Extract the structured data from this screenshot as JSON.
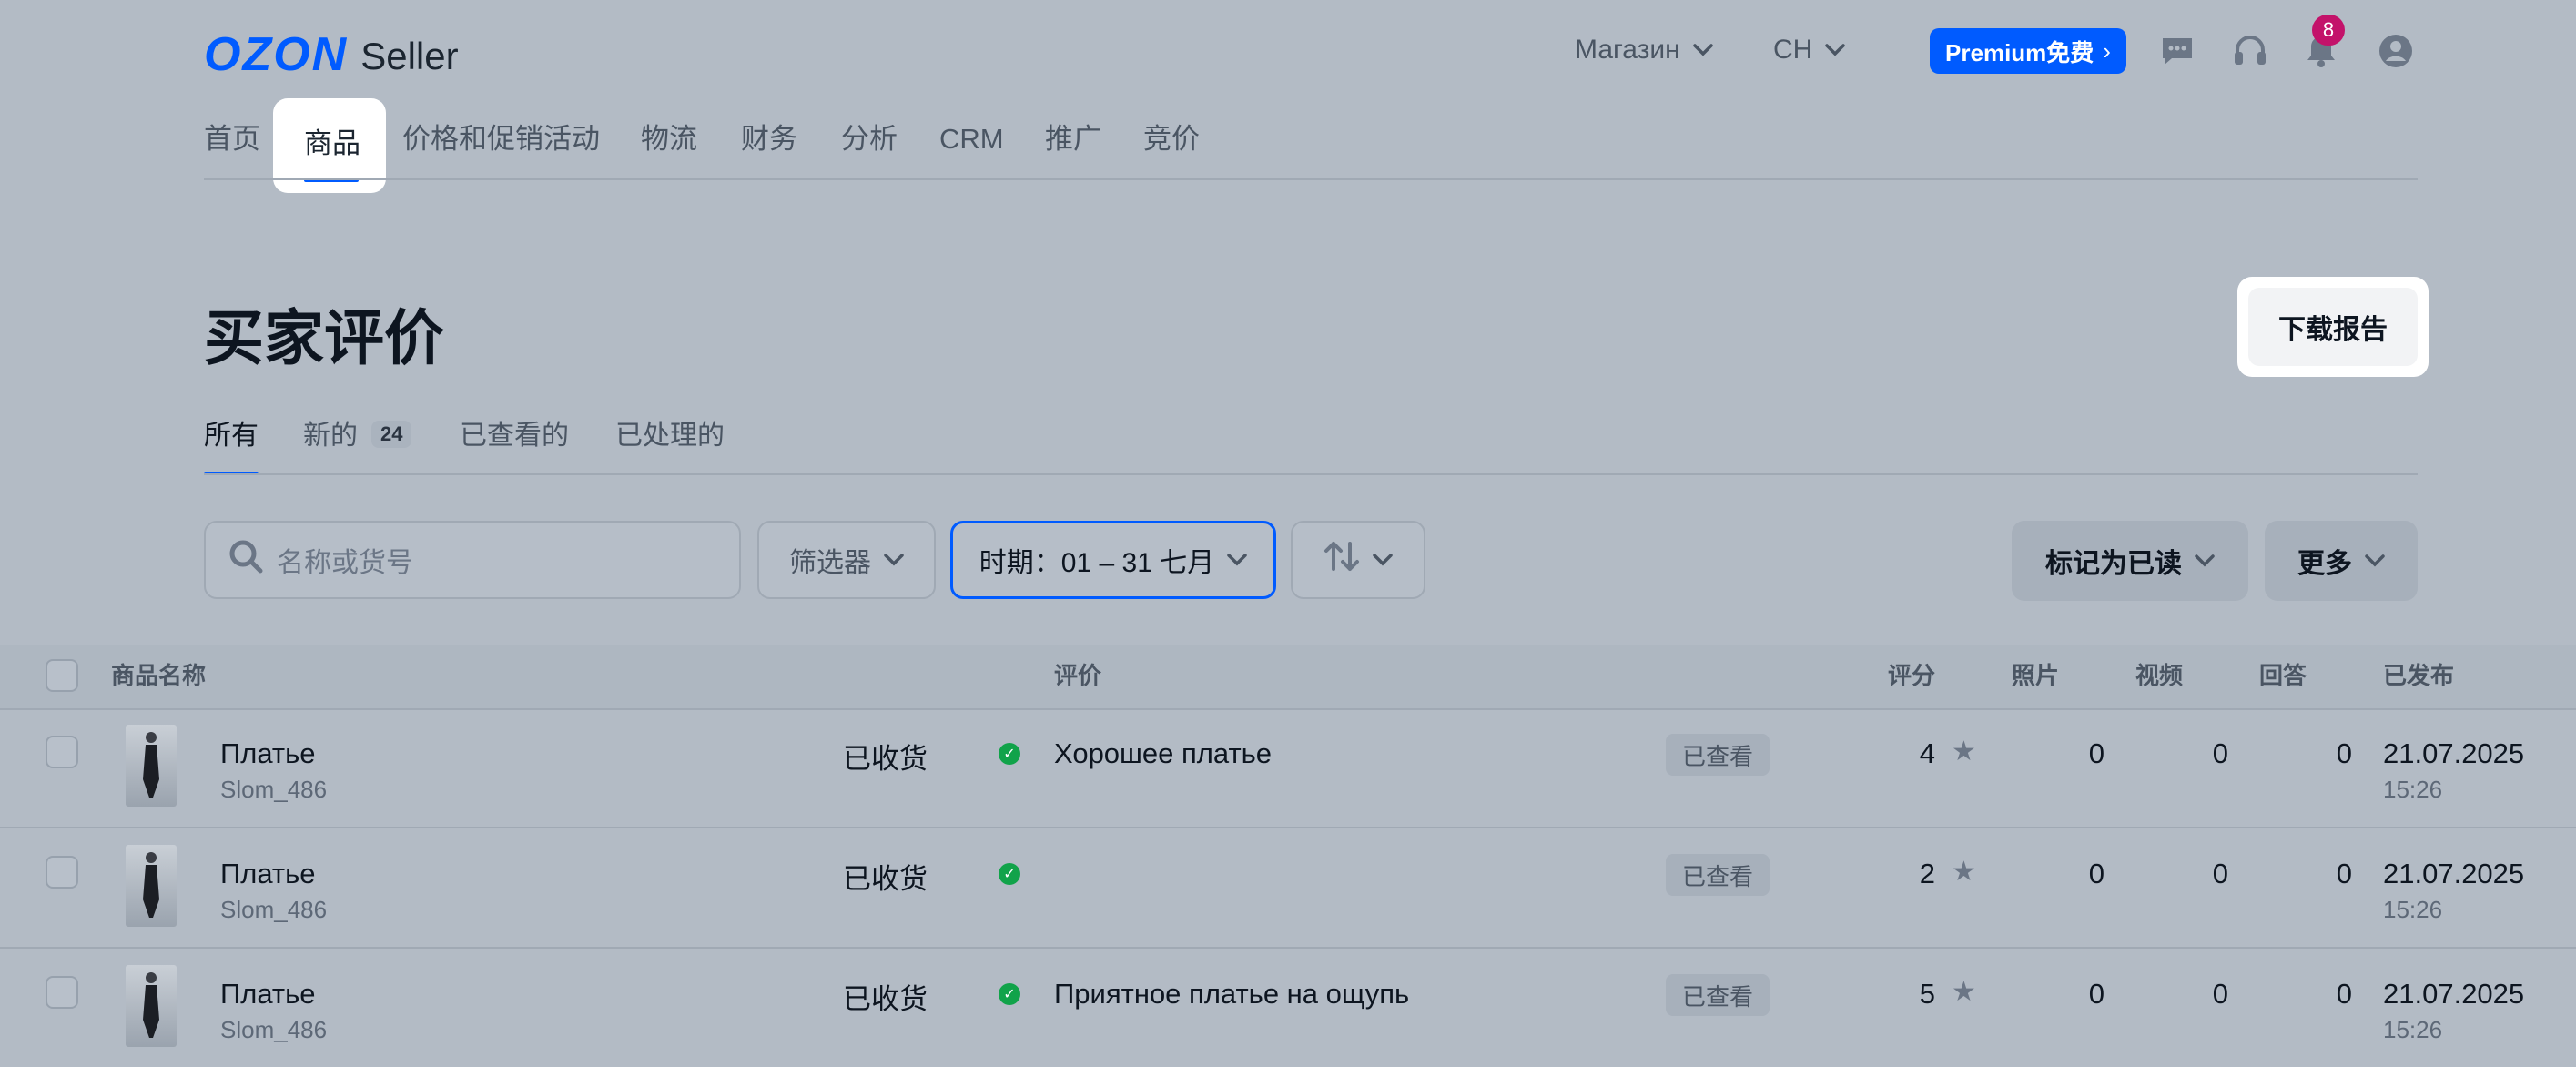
{
  "header": {
    "logo_brand": "OZON",
    "logo_product": "Seller",
    "store_dropdown": "Магазин",
    "lang_dropdown": "CH",
    "premium_label": "Premium免费",
    "notification_count": "8"
  },
  "nav": {
    "items": [
      "首页",
      "商品",
      "价格和促销活动",
      "物流",
      "财务",
      "分析",
      "CRM",
      "推广",
      "竞价"
    ],
    "active": "商品"
  },
  "page": {
    "title": "买家评价",
    "download_button": "下载报告"
  },
  "tabs": [
    {
      "label": "所有",
      "active": true
    },
    {
      "label": "新的",
      "count": "24"
    },
    {
      "label": "已查看的"
    },
    {
      "label": "已处理的"
    }
  ],
  "toolbar": {
    "search_placeholder": "名称或货号",
    "filter_label": "筛选器",
    "period_label": "时期：01 – 31 七月",
    "mark_read_label": "标记为已读",
    "more_label": "更多"
  },
  "table": {
    "columns": {
      "product": "商品名称",
      "review": "评价",
      "rating": "评分",
      "photos": "照片",
      "videos": "视频",
      "replies": "回答",
      "published": "已发布"
    },
    "rows": [
      {
        "name": "Платье",
        "sku": "Slom_486",
        "status": "已收货",
        "review": "Хорошее платье",
        "state": "已查看",
        "rating": "4",
        "photos": "0",
        "videos": "0",
        "replies": "0",
        "date": "21.07.2025",
        "time": "15:26"
      },
      {
        "name": "Платье",
        "sku": "Slom_486",
        "status": "已收货",
        "review": "",
        "state": "已查看",
        "rating": "2",
        "photos": "0",
        "videos": "0",
        "replies": "0",
        "date": "21.07.2025",
        "time": "15:26"
      },
      {
        "name": "Платье",
        "sku": "Slom_486",
        "status": "已收货",
        "review": "Приятное платье на ощупь",
        "state": "已查看",
        "rating": "5",
        "photos": "0",
        "videos": "0",
        "replies": "0",
        "date": "21.07.2025",
        "time": "15:26"
      }
    ]
  },
  "colors": {
    "accent": "#005bff",
    "success": "#11a34a",
    "badge": "#c3126a",
    "overlay_background": "#b3bbc5"
  },
  "icons": [
    "chevron-down-icon",
    "chat-icon",
    "headset-icon",
    "bell-icon",
    "user-icon",
    "search-icon",
    "sort-icon",
    "star-icon",
    "check-circle-icon"
  ]
}
